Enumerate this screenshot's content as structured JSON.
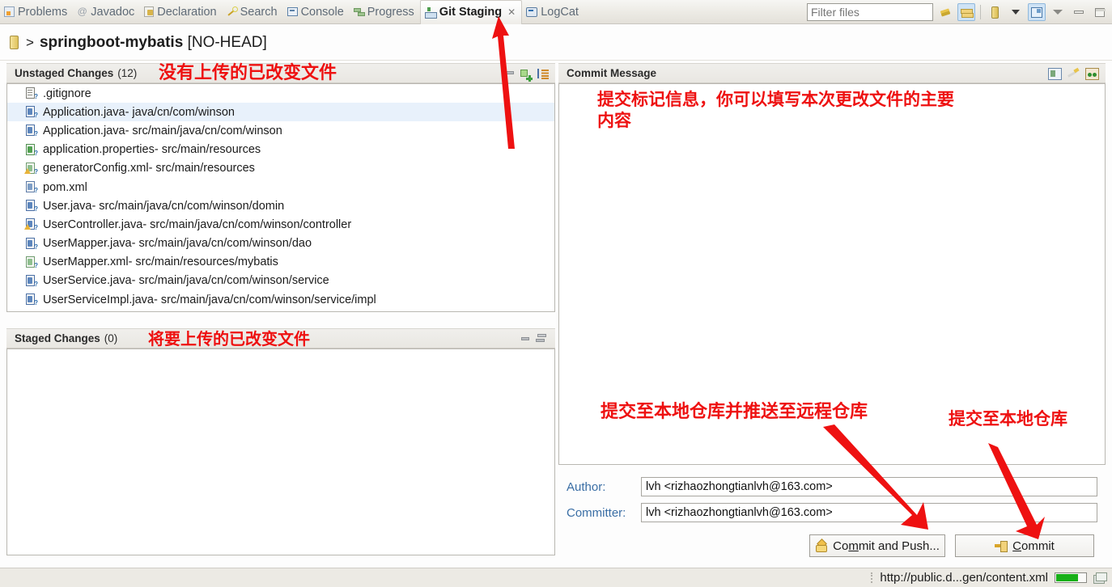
{
  "window": {
    "repo_title_prefix": ">",
    "repo_name": "springboot-mybatis",
    "repo_state": "[NO-HEAD]"
  },
  "tabs": [
    {
      "label": "Problems",
      "icon": "problems-icon",
      "active": false
    },
    {
      "label": "Javadoc",
      "icon": "javadoc-icon",
      "active": false
    },
    {
      "label": "Declaration",
      "icon": "declaration-icon",
      "active": false
    },
    {
      "label": "Search",
      "icon": "search-icon",
      "active": false
    },
    {
      "label": "Console",
      "icon": "console-icon",
      "active": false
    },
    {
      "label": "Progress",
      "icon": "progress-icon",
      "active": false
    },
    {
      "label": "Git Staging",
      "icon": "git-staging-icon",
      "active": true,
      "close": "✕"
    },
    {
      "label": "LogCat",
      "icon": "logcat-icon",
      "active": false
    }
  ],
  "toolbar": {
    "filter_placeholder": "Filter files",
    "filter_value": "",
    "icons": [
      "refresh-icon",
      "synchronize-icon",
      "repository-icon",
      "dropdown-caret-icon",
      "layout-toggle-icon",
      "view-menu-icon",
      "minimize-icon",
      "maximize-icon"
    ]
  },
  "unstaged": {
    "title": "Unstaged Changes",
    "count_label": "(12)",
    "annotation": "没有上传的已改变文件",
    "tools": [
      "stage-icon",
      "add-all-icon",
      "sort-icon"
    ],
    "files": [
      {
        "name": ".gitignore",
        "path": "",
        "kind": "text",
        "selected": false,
        "warn": false
      },
      {
        "name": "Application.java",
        "path": " - java/cn/com/winson",
        "kind": "java",
        "selected": true,
        "warn": false
      },
      {
        "name": "Application.java",
        "path": " - src/main/java/cn/com/winson",
        "kind": "java",
        "selected": false,
        "warn": false
      },
      {
        "name": "application.properties",
        "path": " - src/main/resources",
        "kind": "prop",
        "selected": false,
        "warn": false
      },
      {
        "name": "generatorConfig.xml",
        "path": " - src/main/resources",
        "kind": "xmlg",
        "selected": false,
        "warn": true
      },
      {
        "name": "pom.xml",
        "path": "",
        "kind": "xml",
        "selected": false,
        "warn": false
      },
      {
        "name": "User.java",
        "path": " - src/main/java/cn/com/winson/domin",
        "kind": "java",
        "selected": false,
        "warn": false
      },
      {
        "name": "UserController.java",
        "path": " - src/main/java/cn/com/winson/controller",
        "kind": "java",
        "selected": false,
        "warn": true
      },
      {
        "name": "UserMapper.java",
        "path": " - src/main/java/cn/com/winson/dao",
        "kind": "java",
        "selected": false,
        "warn": false
      },
      {
        "name": "UserMapper.xml",
        "path": " - src/main/resources/mybatis",
        "kind": "xmlg",
        "selected": false,
        "warn": false
      },
      {
        "name": "UserService.java",
        "path": " - src/main/java/cn/com/winson/service",
        "kind": "java",
        "selected": false,
        "warn": false
      },
      {
        "name": "UserServiceImpl.java",
        "path": " - src/main/java/cn/com/winson/service/impl",
        "kind": "java",
        "selected": false,
        "warn": false
      }
    ]
  },
  "staged": {
    "title": "Staged Changes",
    "count_label": "(0)",
    "annotation": "将要上传的已改变文件",
    "tools": [
      "unstage-icon",
      "unstage-all-icon"
    ],
    "files": []
  },
  "commit": {
    "title": "Commit Message",
    "message_value": "",
    "tools": [
      "add-signed-off-icon",
      "amend-icon",
      "add-change-id-icon"
    ],
    "annotation": "提交标记信息，你可以填写本次更改文件的主要\n内容",
    "author_label": "Author:",
    "author_value": "lvh <rizhaozhongtianlvh@163.com>",
    "committer_label": "Committer:",
    "committer_value": "lvh <rizhaozhongtianlvh@163.com>",
    "commit_push_button": "Commit and Push...",
    "commit_push_mnemonic_pre": "Co",
    "commit_push_mnemonic_char": "m",
    "commit_push_mnemonic_post": "mit and Push...",
    "commit_button": "Commit",
    "commit_mnemonic_char": "C",
    "commit_mnemonic_post": "ommit",
    "annotation_push": "提交至本地仓库并推送至远程仓库",
    "annotation_commit": "提交至本地仓库"
  },
  "statusbar": {
    "text": "http://public.d...gen/content.xml",
    "progress_percent": 70
  },
  "colors": {
    "annotation_red": "#ee1111",
    "selection_blue": "#e8f1fb",
    "label_blue": "#3a6ea5",
    "progress_green": "#18b018"
  }
}
